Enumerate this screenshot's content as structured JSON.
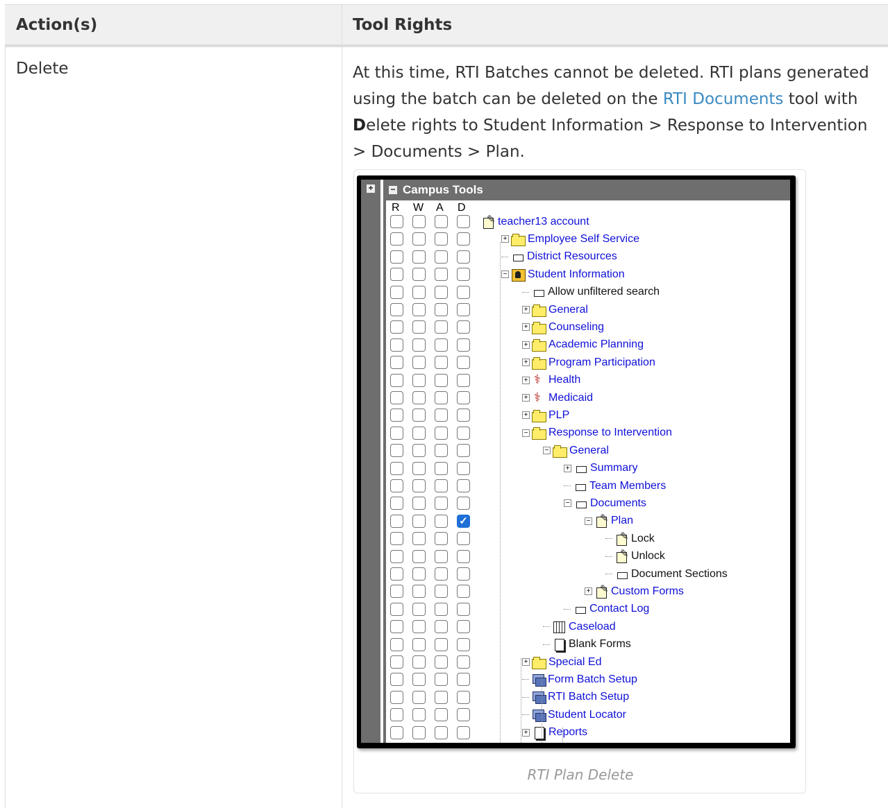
{
  "table": {
    "col1_header": "Action(s)",
    "col2_header": "Tool Rights",
    "rows": [
      {
        "action": "Delete",
        "text_before_link": "At this time, RTI Batches cannot be deleted. RTI plans generated using the batch can be deleted on the ",
        "link_text": "RTI Documents",
        "text_after_link": " tool with ",
        "bold_letter": "D",
        "text_end": "elete rights to Student Information > Response to Intervention > Documents > Plan."
      }
    ]
  },
  "figure": {
    "caption": "RTI Plan Delete",
    "panel_title": "Campus Tools",
    "rail_expand_glyph": "+",
    "title_collapse_glyph": "−",
    "columns": [
      "R",
      "W",
      "A",
      "D"
    ],
    "tree": [
      {
        "label": "teacher13 account",
        "icon": "edit-icon",
        "checked": [
          false,
          false,
          false,
          false
        ]
      },
      {
        "label": "Employee Self Service",
        "icon": "folder-icon",
        "expander": "+",
        "checked": [
          false,
          false,
          false,
          false
        ]
      },
      {
        "label": "District Resources",
        "icon": "page-icon",
        "checked": [
          false,
          false,
          false,
          false
        ]
      },
      {
        "label": "Student Information",
        "icon": "person-icon",
        "expander": "−",
        "checked": [
          false,
          false,
          false,
          false
        ]
      },
      {
        "label": "Allow unfiltered search",
        "icon": "page-icon",
        "checked": [
          false,
          false,
          false,
          false
        ]
      },
      {
        "label": "General",
        "icon": "folder-icon",
        "expander": "+",
        "checked": [
          false,
          false,
          false,
          false
        ]
      },
      {
        "label": "Counseling",
        "icon": "folder-icon",
        "expander": "+",
        "checked": [
          false,
          false,
          false,
          false
        ]
      },
      {
        "label": "Academic Planning",
        "icon": "folder-icon",
        "expander": "+",
        "checked": [
          false,
          false,
          false,
          false
        ]
      },
      {
        "label": "Program Participation",
        "icon": "folder-icon",
        "expander": "+",
        "checked": [
          false,
          false,
          false,
          false
        ]
      },
      {
        "label": "Health",
        "icon": "health-icon",
        "expander": "+",
        "checked": [
          false,
          false,
          false,
          false
        ]
      },
      {
        "label": "Medicaid",
        "icon": "health-icon",
        "expander": "+",
        "checked": [
          false,
          false,
          false,
          false
        ]
      },
      {
        "label": "PLP",
        "icon": "folder-icon",
        "expander": "+",
        "checked": [
          false,
          false,
          false,
          false
        ]
      },
      {
        "label": "Response to Intervention",
        "icon": "folder-icon",
        "expander": "−",
        "checked": [
          false,
          false,
          false,
          false
        ]
      },
      {
        "label": "General",
        "icon": "folder-icon",
        "expander": "−",
        "checked": [
          false,
          false,
          false,
          false
        ]
      },
      {
        "label": "Summary",
        "icon": "page-icon",
        "expander": "+",
        "checked": [
          false,
          false,
          false,
          false
        ]
      },
      {
        "label": "Team Members",
        "icon": "page-icon",
        "checked": [
          false,
          false,
          false,
          false
        ]
      },
      {
        "label": "Documents",
        "icon": "page-icon",
        "expander": "−",
        "checked": [
          false,
          false,
          false,
          false
        ]
      },
      {
        "label": "Plan",
        "icon": "edit-icon",
        "expander": "−",
        "checked": [
          false,
          false,
          false,
          true
        ]
      },
      {
        "label": "Lock",
        "icon": "edit-icon",
        "checked": [
          false,
          false,
          false,
          false
        ]
      },
      {
        "label": "Unlock",
        "icon": "edit-icon",
        "checked": [
          false,
          false,
          false,
          false
        ]
      },
      {
        "label": "Document Sections",
        "icon": "page-icon",
        "checked": [
          false,
          false,
          false,
          false
        ]
      },
      {
        "label": "Custom Forms",
        "icon": "edit-icon",
        "expander": "+",
        "checked": [
          false,
          false,
          false,
          false
        ]
      },
      {
        "label": "Contact Log",
        "icon": "page-icon",
        "checked": [
          false,
          false,
          false,
          false
        ]
      },
      {
        "label": "Caseload",
        "icon": "grid-icon",
        "checked": [
          false,
          false,
          false,
          false
        ]
      },
      {
        "label": "Blank Forms",
        "icon": "doc-icon",
        "checked": [
          false,
          false,
          false,
          false
        ]
      },
      {
        "label": "Special Ed",
        "icon": "folder-icon",
        "expander": "+",
        "checked": [
          false,
          false,
          false,
          false
        ]
      },
      {
        "label": "Form Batch Setup",
        "icon": "batch-icon",
        "checked": [
          false,
          false,
          false,
          false
        ]
      },
      {
        "label": "RTI Batch Setup",
        "icon": "batch-icon",
        "checked": [
          false,
          false,
          false,
          false
        ]
      },
      {
        "label": "Student Locator",
        "icon": "batch-icon",
        "checked": [
          false,
          false,
          false,
          false
        ]
      },
      {
        "label": "Reports",
        "icon": "doc-icon",
        "expander": "+",
        "checked": [
          false,
          false,
          false,
          false
        ]
      }
    ],
    "colors": {
      "link": "#3b8ac2",
      "tree_link": "#1010d8",
      "checkbox_checked": "#1f6fd6"
    }
  }
}
